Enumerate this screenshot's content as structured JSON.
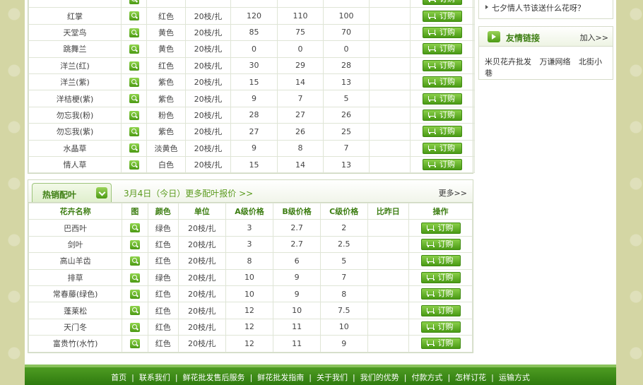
{
  "order_label": "订购",
  "top_table": {
    "rows": [
      {
        "name": "红掌",
        "color": "红色",
        "unit": "20枝/扎",
        "a": "120",
        "b": "110",
        "c": "100"
      },
      {
        "name": "天堂鸟",
        "color": "黄色",
        "unit": "20枝/扎",
        "a": "85",
        "b": "75",
        "c": "70"
      },
      {
        "name": "跳舞兰",
        "color": "黄色",
        "unit": "20枝/扎",
        "a": "0",
        "b": "0",
        "c": "0"
      },
      {
        "name": "洋兰(红)",
        "color": "红色",
        "unit": "20枝/扎",
        "a": "30",
        "b": "29",
        "c": "28"
      },
      {
        "name": "洋兰(紫)",
        "color": "紫色",
        "unit": "20枝/扎",
        "a": "15",
        "b": "14",
        "c": "13"
      },
      {
        "name": "洋桔梗(紫)",
        "color": "紫色",
        "unit": "20枝/扎",
        "a": "9",
        "b": "7",
        "c": "5"
      },
      {
        "name": "勿忘我(粉)",
        "color": "粉色",
        "unit": "20枝/扎",
        "a": "28",
        "b": "27",
        "c": "26"
      },
      {
        "name": "勿忘我(紫)",
        "color": "紫色",
        "unit": "20枝/扎",
        "a": "27",
        "b": "26",
        "c": "25"
      },
      {
        "name": "水晶草",
        "color": "淡黄色",
        "unit": "20枝/扎",
        "a": "9",
        "b": "8",
        "c": "7"
      },
      {
        "name": "情人草",
        "color": "白色",
        "unit": "20枝/扎",
        "a": "15",
        "b": "14",
        "c": "13"
      }
    ]
  },
  "hot": {
    "tab_label": "热销配叶",
    "date_text": "3月4日（今日）更多配叶报价 >>",
    "more": "更多>>",
    "headers": [
      "花卉名称",
      "图",
      "颜色",
      "单位",
      "A级价格",
      "B级价格",
      "C级价格",
      "比昨日",
      "操作"
    ],
    "rows": [
      {
        "name": "巴西叶",
        "color": "绿色",
        "unit": "20枝/扎",
        "a": "3",
        "b": "2.7",
        "c": "2"
      },
      {
        "name": "剑叶",
        "color": "红色",
        "unit": "20枝/扎",
        "a": "3",
        "b": "2.7",
        "c": "2.5"
      },
      {
        "name": "高山羊齿",
        "color": "红色",
        "unit": "20枝/扎",
        "a": "8",
        "b": "6",
        "c": "5"
      },
      {
        "name": "排草",
        "color": "绿色",
        "unit": "20枝/扎",
        "a": "10",
        "b": "9",
        "c": "7"
      },
      {
        "name": "常春藤(绿色)",
        "color": "红色",
        "unit": "20枝/扎",
        "a": "10",
        "b": "9",
        "c": "8"
      },
      {
        "name": "蓬莱松",
        "color": "红色",
        "unit": "20枝/扎",
        "a": "12",
        "b": "10",
        "c": "7.5"
      },
      {
        "name": "天门冬",
        "color": "红色",
        "unit": "20枝/扎",
        "a": "12",
        "b": "11",
        "c": "10"
      },
      {
        "name": "富贵竹(水竹)",
        "color": "红色",
        "unit": "20枝/扎",
        "a": "12",
        "b": "11",
        "c": "9"
      }
    ]
  },
  "sidebar": {
    "news_item": "七夕情人节该送什么花呀？",
    "links_title": "友情链接",
    "links_join": "加入>>",
    "links": [
      "米贝花卉批发",
      "万谦网络",
      "北街小巷"
    ]
  },
  "footer": {
    "nav": [
      "首页",
      "联系我们",
      "鲜花批发售后服务",
      "鲜花批发指南",
      "关于我们",
      "我们的优势",
      "付款方式",
      "怎样订花",
      "运输方式"
    ]
  }
}
